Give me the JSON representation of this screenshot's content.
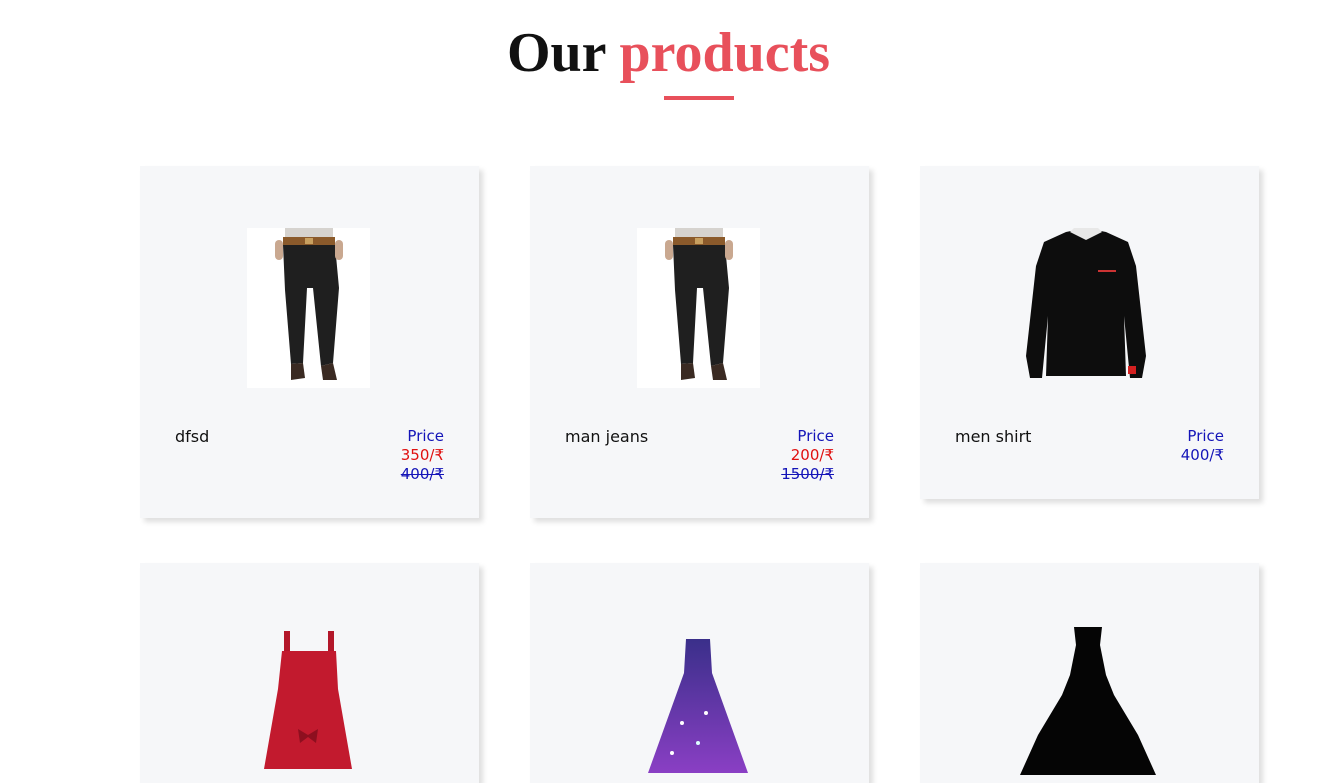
{
  "heading": {
    "word1": "Our",
    "word2": "products"
  },
  "colors": {
    "accent": "#e8505b",
    "price_blue": "#1414b8",
    "price_red": "#e01010",
    "card_bg": "#f6f7f9"
  },
  "products": [
    {
      "name": "dfsd",
      "price_label": "Price",
      "price_current": "350/₹",
      "price_original": "400/₹",
      "image": "black-jeans-image"
    },
    {
      "name": "man jeans",
      "price_label": "Price",
      "price_current": "200/₹",
      "price_original": "1500/₹",
      "image": "black-jeans-image"
    },
    {
      "name": "men shirt",
      "price_label": "Price",
      "price_current": "400/₹",
      "image": "black-shirt-image"
    },
    {
      "name": "",
      "image": "red-dress-image"
    },
    {
      "name": "",
      "image": "purple-gown-image"
    },
    {
      "name": "",
      "image": "black-gown-image"
    }
  ]
}
